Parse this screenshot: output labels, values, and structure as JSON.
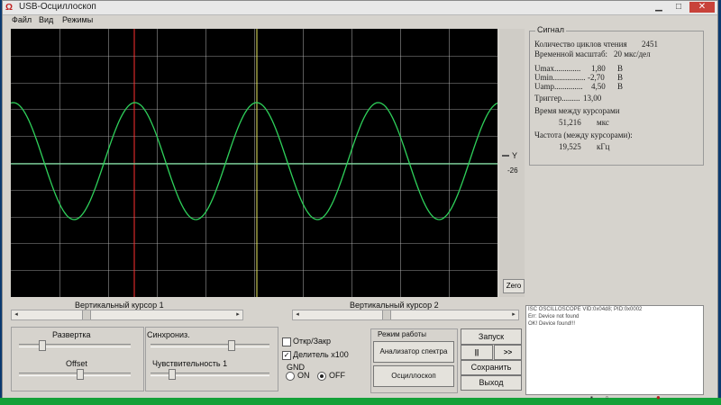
{
  "window": {
    "title": "USB-Осциллоскоп",
    "controls": {
      "minimize": "▁",
      "maximize": "□",
      "close": "✕"
    }
  },
  "menu": [
    "Файл",
    "Вид",
    "Режимы"
  ],
  "scope": {
    "y_label": "Y",
    "y_value": "-26",
    "zoom_button": "Zero",
    "trace_color": "#2ed05a",
    "grid_color": "#bcbcbc",
    "cursor1_color": "#ff3030",
    "cursor2_color": "#e8e860"
  },
  "signal": {
    "legend": "Сигнал",
    "read_cycles_label": "Количество циклов чтения",
    "read_cycles_value": "2451",
    "time_scale_label": "Временной масштаб:",
    "time_scale_value": "20 мкс/дел",
    "umax_label": "Umax.............",
    "umax_value": "1,80",
    "umax_unit": "В",
    "umin_label": "Umin................",
    "umin_value": "-2,70",
    "umin_unit": "В",
    "uamp_label": "Uamp..............",
    "uamp_value": "4,50",
    "uamp_unit": "В",
    "trigger_label": "Триггер.........",
    "trigger_value": "13,00",
    "time_between_label": "Время между курсорами",
    "time_between_value": "51,216",
    "time_between_unit": "мкс",
    "freq_between_label": "Частота (между курсорами):",
    "freq_between_value": "19,525",
    "freq_between_unit": "кГц"
  },
  "cursors": {
    "cursor1_label": "Вертикальный курсор 1",
    "cursor2_label": "Вертикальный курсор 2",
    "cursor1_position": 0.3,
    "cursor2_position": 0.4
  },
  "controls": {
    "sweep_label": "Развертка",
    "offset_label": "Offset",
    "sync_label": "Синхрониз.",
    "sensitivity_label": "Чувствительность 1",
    "open_closed_label": "Откр/Закр",
    "open_closed_checked": false,
    "divider_label": "Делитель x100",
    "divider_checked": true,
    "gnd_label": "GND",
    "gnd_on_label": "ON",
    "gnd_off_label": "OFF",
    "mode_label": "Режим работы",
    "spectrum_button": "Анализатор спектра",
    "oscilloscope_button": "Осциллоскоп",
    "start_button": "Запуск",
    "pause_button": "||",
    "forward_button": ">>",
    "save_button": "Сохранить",
    "exit_button": "Выход"
  },
  "log": [
    "ISC OSCILLOSCOPE VID:0x04d8; PID:0x0002",
    "Err: Device not found",
    "OK! Device found!!!"
  ]
}
